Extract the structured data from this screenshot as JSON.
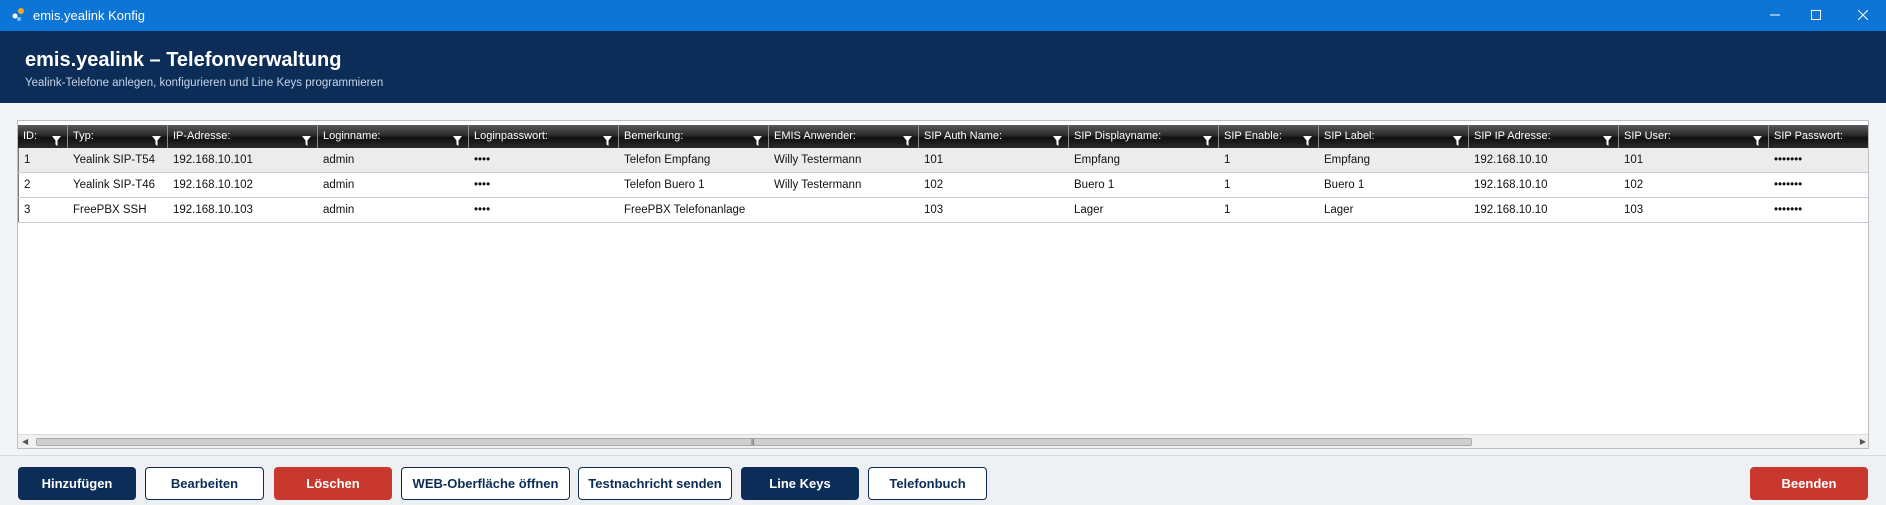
{
  "window": {
    "title": "emis.yealink Konfig"
  },
  "header": {
    "title": "emis.yealink – Telefonverwaltung",
    "subtitle": "Yealink-Telefone anlegen, konfigurieren und Line Keys programmieren"
  },
  "table": {
    "columns": [
      "ID:",
      "Typ:",
      "IP-Adresse:",
      "Loginname:",
      "Loginpasswort:",
      "Bemerkung:",
      "EMIS Anwender:",
      "SIP Auth Name:",
      "SIP Displayname:",
      "SIP Enable:",
      "SIP Label:",
      "SIP IP Adresse:",
      "SIP User:",
      "SIP Passwort:"
    ],
    "rows": [
      [
        "1",
        "Yealink SIP-T54",
        "192.168.10.101",
        "admin",
        "••••",
        "Telefon Empfang",
        "Willy Testermann",
        "101",
        "Empfang",
        "1",
        "Empfang",
        "192.168.10.10",
        "101",
        "•••••••"
      ],
      [
        "2",
        "Yealink SIP-T46",
        "192.168.10.102",
        "admin",
        "••••",
        "Telefon Buero 1",
        "Willy Testermann",
        "102",
        "Buero 1",
        "1",
        "Buero 1",
        "192.168.10.10",
        "102",
        "•••••••"
      ],
      [
        "3",
        "FreePBX SSH",
        "192.168.10.103",
        "admin",
        "••••",
        "FreePBX Telefonanlage",
        "",
        "103",
        "Lager",
        "1",
        "Lager",
        "192.168.10.10",
        "103",
        "•••••••"
      ]
    ]
  },
  "buttons": {
    "add": "Hinzufügen",
    "edit": "Bearbeiten",
    "delete": "Löschen",
    "web": "WEB-Oberfläche öffnen",
    "test": "Testnachricht senden",
    "linekeys": "Line Keys",
    "phonebook": "Telefonbuch",
    "quit": "Beenden"
  },
  "colors": {
    "titlebar": "#0c75d6",
    "header": "#0b2d57",
    "primary": "#0b2d57",
    "danger": "#c8382e"
  },
  "icons": {
    "app": "app-logo-icon",
    "filter": "filter-icon",
    "minimize": "minimize-icon",
    "maximize": "maximize-icon",
    "close": "close-icon"
  }
}
